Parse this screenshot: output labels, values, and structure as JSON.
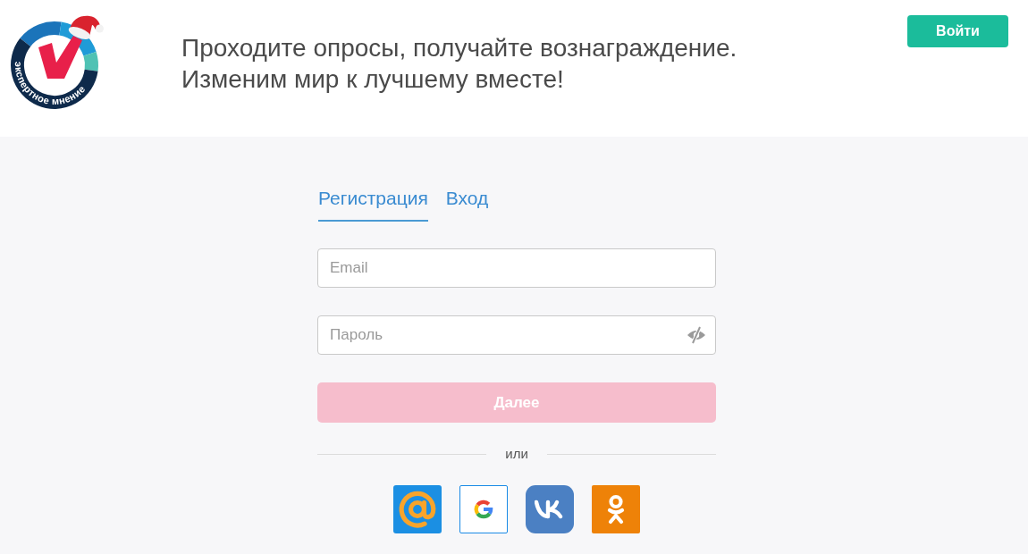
{
  "header": {
    "logo": {
      "text": "экспертное мнение"
    },
    "tagline": [
      "Проходите опросы, получайте вознаграждение.",
      "Изменим мир к лучшему вместе!"
    ],
    "login_button": "Войти"
  },
  "tabs": [
    {
      "label": "Регистрация",
      "selected": true
    },
    {
      "label": "Вход",
      "selected": false
    }
  ],
  "fields": [
    {
      "kind": "email",
      "placeholder": "Email"
    },
    {
      "kind": "password",
      "placeholder": "Пароль"
    }
  ],
  "submit": {
    "label": "Далее",
    "disabled": true
  },
  "divider": "или",
  "social_buttons": [
    {
      "kind": "mail"
    },
    {
      "kind": "google"
    },
    {
      "kind": "vk"
    },
    {
      "kind": "ok"
    }
  ]
}
